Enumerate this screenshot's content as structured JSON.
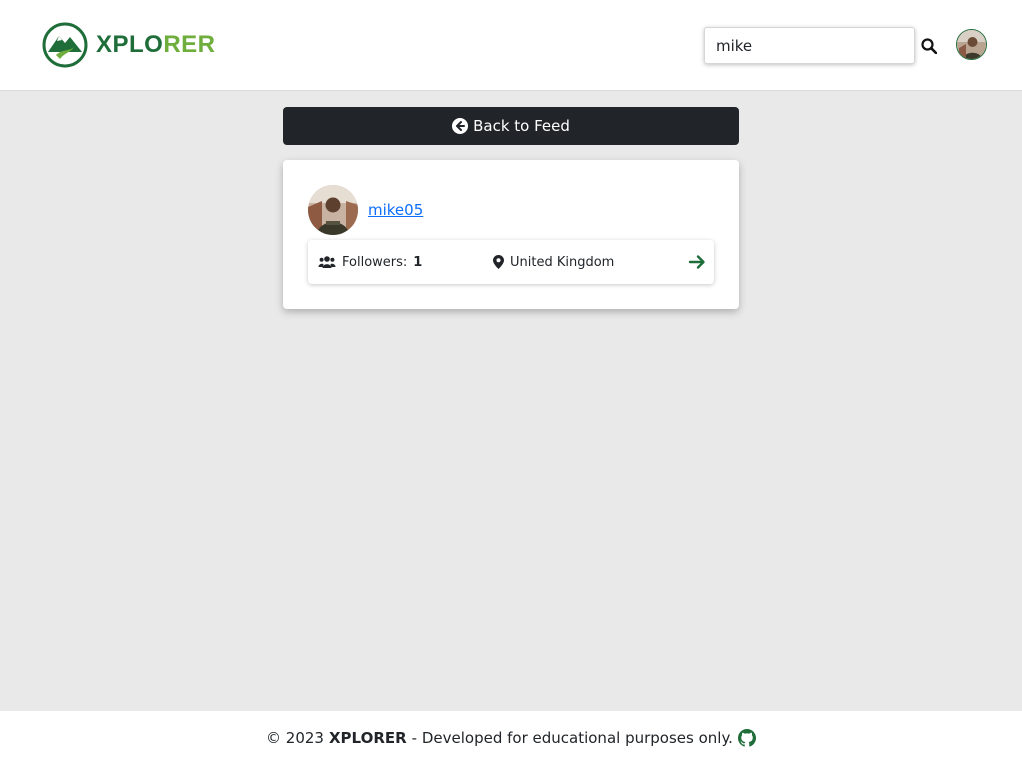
{
  "brand": {
    "name_part1": "XPLO",
    "name_part2": "RER",
    "primary_color": "#1f6e3a",
    "secondary_color": "#6fae3d"
  },
  "search": {
    "value": "mike",
    "icon": "search-icon"
  },
  "nav": {
    "avatar_icon": "user-avatar"
  },
  "back_button": {
    "label": "Back to Feed",
    "icon": "arrow-circle-left-icon"
  },
  "result": {
    "username": "mike05",
    "followers_label": "Followers:",
    "followers_count": "1",
    "location": "United Kingdom",
    "link_color": "#0d6efd"
  },
  "footer": {
    "prefix": "© 2023",
    "brand": "XPLORER",
    "suffix": "- Developed for educational purposes only.",
    "icon": "github-icon"
  }
}
